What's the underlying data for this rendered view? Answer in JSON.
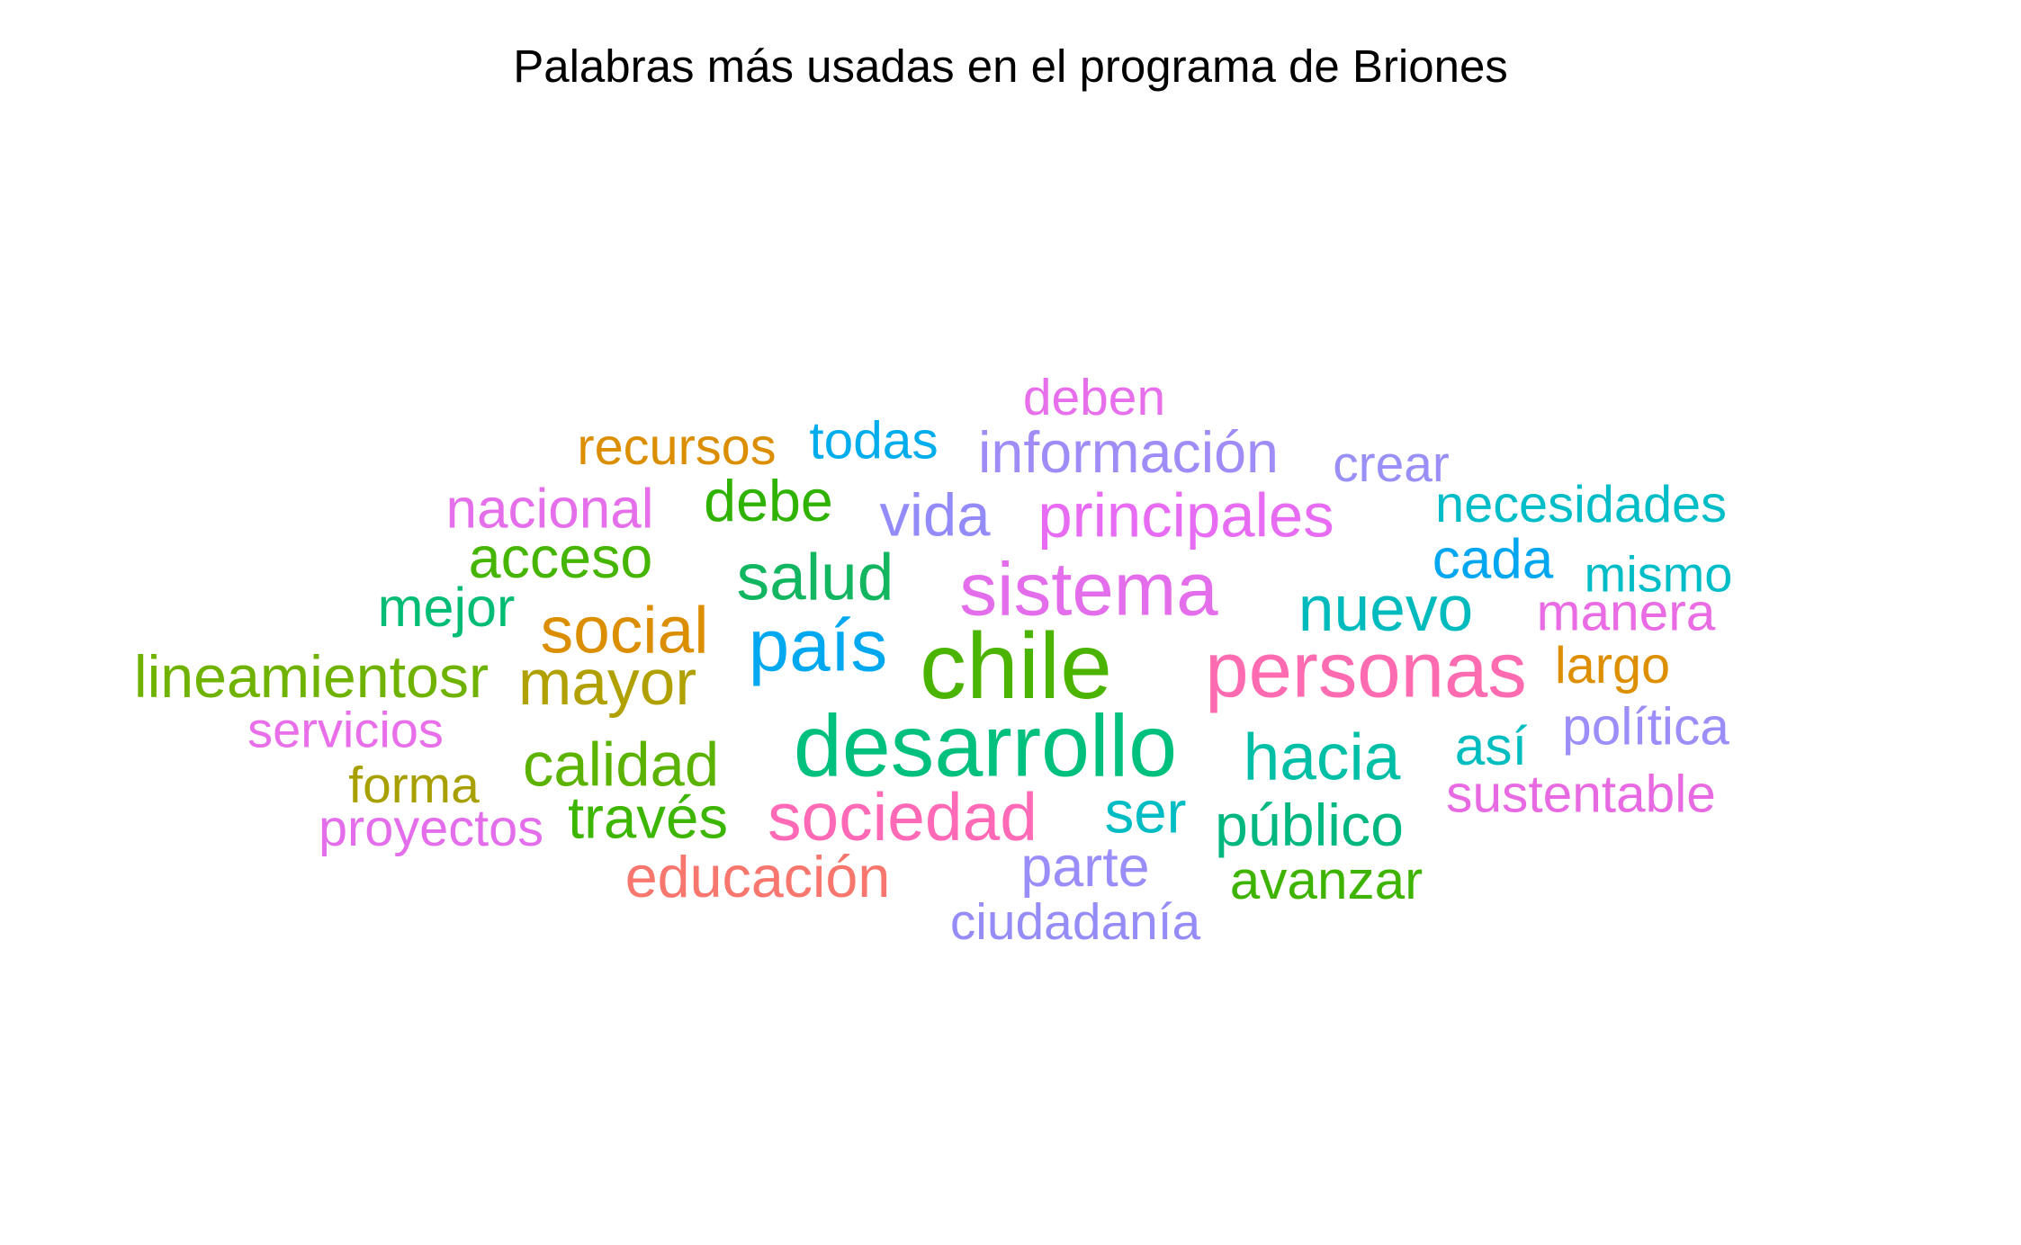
{
  "chart_data": {
    "type": "wordcloud",
    "title": "Palabras más usadas en el programa de Briones",
    "words": [
      {
        "word": "chile",
        "frequency": 100,
        "color": "#4BB400"
      },
      {
        "word": "desarrollo",
        "frequency": 92,
        "color": "#00C07E"
      },
      {
        "word": "personas",
        "frequency": 80,
        "color": "#FF6BB1"
      },
      {
        "word": "sistema",
        "frequency": 76,
        "color": "#E46DEC"
      },
      {
        "word": "país",
        "frequency": 74,
        "color": "#00A8F0"
      },
      {
        "word": "sociedad",
        "frequency": 66,
        "color": "#FF69B6"
      },
      {
        "word": "hacia",
        "frequency": 64,
        "color": "#00BFA7"
      },
      {
        "word": "salud",
        "frequency": 64,
        "color": "#13B660"
      },
      {
        "word": "social",
        "frequency": 64,
        "color": "#DB8E00"
      },
      {
        "word": "mayor",
        "frequency": 62,
        "color": "#B0A100"
      },
      {
        "word": "nuevo",
        "frequency": 62,
        "color": "#00BBBD"
      },
      {
        "word": "calidad",
        "frequency": 59,
        "color": "#5BB300"
      },
      {
        "word": "principales",
        "frequency": 59,
        "color": "#E76BF3"
      },
      {
        "word": "vida",
        "frequency": 57,
        "color": "#938BF9"
      },
      {
        "word": "lineamientosr",
        "frequency": 56,
        "color": "#6FB300"
      },
      {
        "word": "público",
        "frequency": 56,
        "color": "#00B87F"
      },
      {
        "word": "ser",
        "frequency": 55,
        "color": "#00BCC3"
      },
      {
        "word": "través",
        "frequency": 55,
        "color": "#3CB600"
      },
      {
        "word": "acceso",
        "frequency": 54,
        "color": "#45B500"
      },
      {
        "word": "debe",
        "frequency": 54,
        "color": "#2FB300"
      },
      {
        "word": "educación",
        "frequency": 54,
        "color": "#F7766D"
      },
      {
        "word": "información",
        "frequency": 54,
        "color": "#A08CF6"
      },
      {
        "word": "parte",
        "frequency": 52,
        "color": "#998DF9"
      },
      {
        "word": "cada",
        "frequency": 51,
        "color": "#00A7F0"
      },
      {
        "word": "nacional",
        "frequency": 51,
        "color": "#E56EEB"
      },
      {
        "word": "mejor",
        "frequency": 50,
        "color": "#00BC74"
      },
      {
        "word": "así",
        "frequency": 49,
        "color": "#00BDC0"
      },
      {
        "word": "avanzar",
        "frequency": 49,
        "color": "#3FB400"
      },
      {
        "word": "manera",
        "frequency": 47,
        "color": "#E96CE4"
      },
      {
        "word": "política",
        "frequency": 47,
        "color": "#9C8EF9"
      },
      {
        "word": "sustentable",
        "frequency": 47,
        "color": "#E86AE2"
      },
      {
        "word": "todas",
        "frequency": 47,
        "color": "#00ADEC"
      },
      {
        "word": "largo",
        "frequency": 46,
        "color": "#DD8F00"
      },
      {
        "word": "necesidades",
        "frequency": 46,
        "color": "#00BDC7"
      },
      {
        "word": "recursos",
        "frequency": 46,
        "color": "#DB8E00"
      },
      {
        "word": "proyectos",
        "frequency": 46,
        "color": "#E46DEC"
      },
      {
        "word": "ciudadanía",
        "frequency": 45,
        "color": "#968CF7"
      },
      {
        "word": "crear",
        "frequency": 45,
        "color": "#998FF7"
      },
      {
        "word": "deben",
        "frequency": 45,
        "color": "#E76FEC"
      },
      {
        "word": "forma",
        "frequency": 45,
        "color": "#A7A000"
      },
      {
        "word": "mismo",
        "frequency": 44,
        "color": "#00BDC7"
      },
      {
        "word": "servicios",
        "frequency": 44,
        "color": "#E86EEA"
      }
    ]
  }
}
